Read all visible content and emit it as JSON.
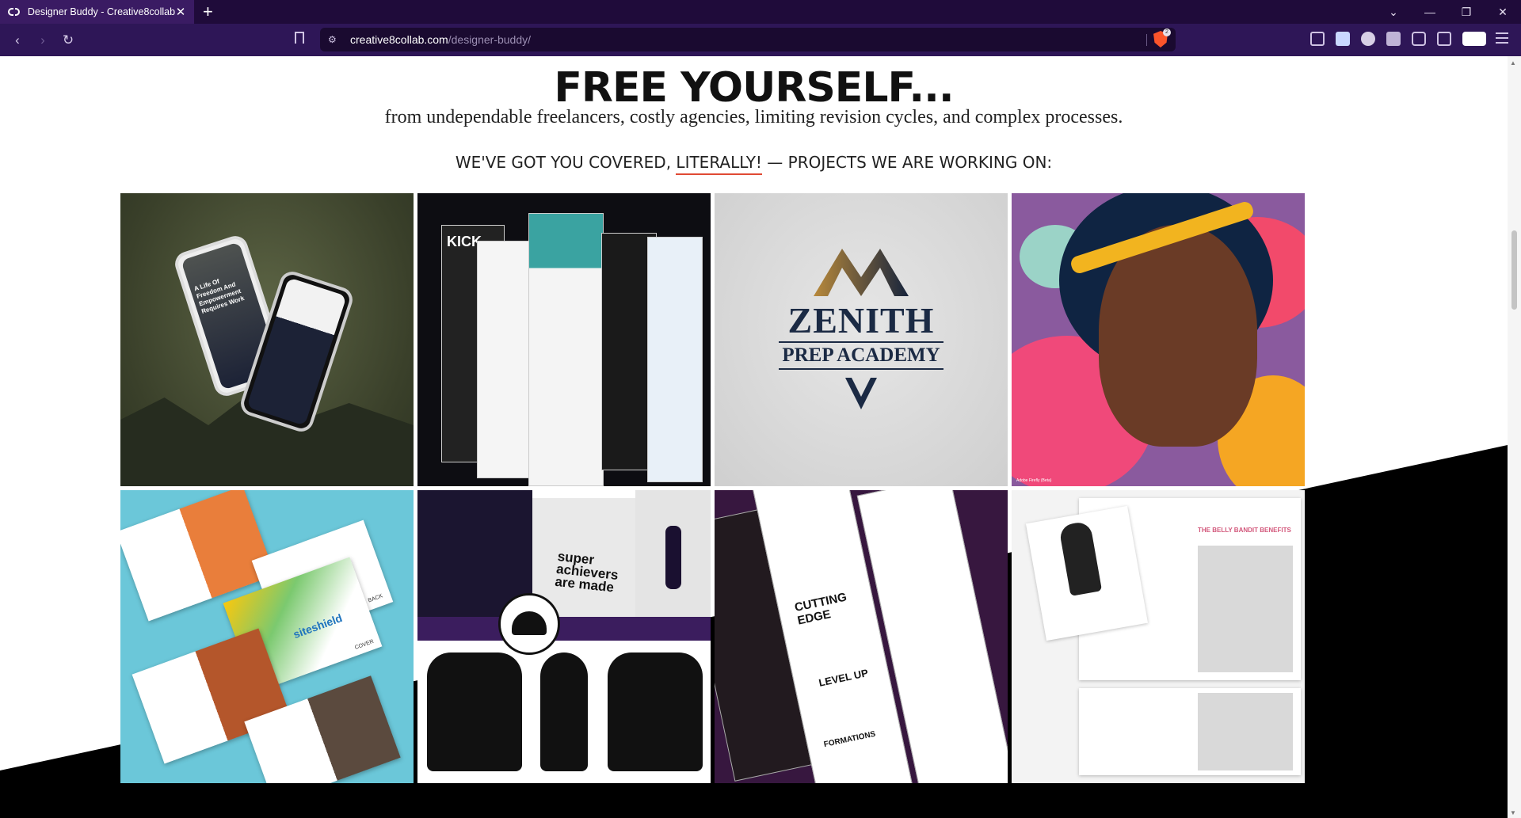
{
  "browser": {
    "tab_title": "Designer Buddy - Creative8collab",
    "url_domain": "creative8collab.com",
    "url_path": "/designer-buddy/",
    "shields_count": "2",
    "window_controls": [
      "chevron-down-icon",
      "minimize-icon",
      "restore-icon",
      "close-icon"
    ],
    "nav_icons": [
      "back-icon",
      "forward-icon",
      "reload-icon",
      "bookmark-icon"
    ],
    "extension_icons": [
      "camera-icon",
      "page-icon",
      "mask-icon",
      "feather-icon",
      "puzzle-icon",
      "sidebar-icon",
      "glasses-icon",
      "menu-icon"
    ]
  },
  "hero": {
    "headline": "FREE YOURSELF...",
    "subline": "from undependable freelancers, costly agencies, limiting revision cycles, and complex processes.",
    "covered_prefix": "WE'VE GOT YOU COVERED, ",
    "covered_emphasis": "LITERALLY!",
    "covered_suffix": " — PROJECTS WE ARE WORKING ON:"
  },
  "portfolio": {
    "items": [
      {
        "name": "mobile-app-mockup",
        "phone_text": "A Life Of Freedom And Empowerment Requires Work"
      },
      {
        "name": "website-mockups",
        "kick_text": "KICK"
      },
      {
        "name": "zenith-logo",
        "logo_name": "ZENITH",
        "logo_sub": "PREP ACADEMY"
      },
      {
        "name": "illustration-portrait",
        "caption": "Adobe Firefly (Beta)"
      },
      {
        "name": "siteshield-brochure",
        "brand": "siteshield",
        "back_label": "BACK",
        "cover_label": "COVER"
      },
      {
        "name": "apparel-merch",
        "tote_text": "super achievers are made"
      },
      {
        "name": "beauty-website-mockups",
        "cutting_edge": "CUTTING EDGE",
        "level_up": "LEVEL UP",
        "formations": "FORMATIONS"
      },
      {
        "name": "belly-bandit-catalog",
        "heading": "THE BELLY BANDIT BENEFITS"
      }
    ]
  },
  "colors": {
    "tabbar_bg": "#1f0b3a",
    "toolbar_bg": "#2e1657",
    "accent_underline": "#e04a34",
    "brave_orange": "#fb542b"
  }
}
